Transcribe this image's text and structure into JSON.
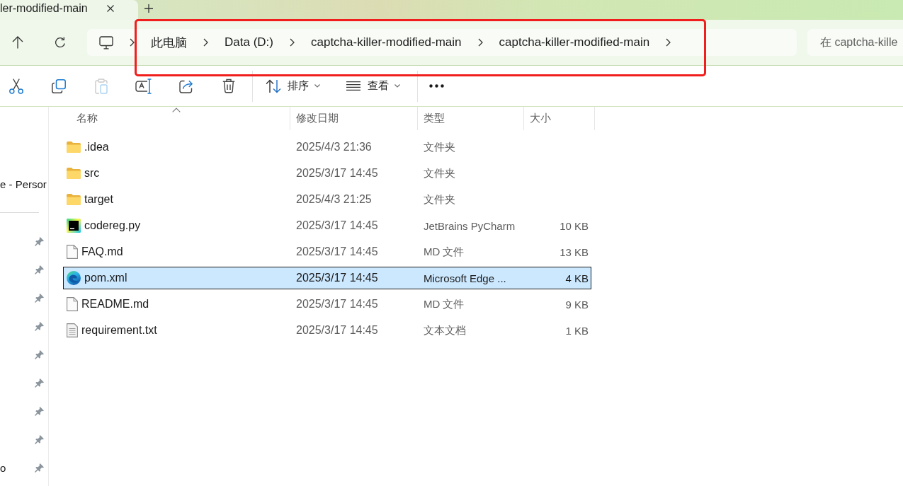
{
  "tab": {
    "title": "ler-modified-main"
  },
  "address_bar": {
    "breadcrumbs": [
      {
        "label": "此电脑"
      },
      {
        "label": "Data (D:)"
      },
      {
        "label": "captcha-killer-modified-main"
      },
      {
        "label": "captcha-killer-modified-main"
      }
    ]
  },
  "search": {
    "placeholder": "在 captcha-kille"
  },
  "toolbar": {
    "actions": [
      {
        "kind": "cut",
        "disabled": false
      },
      {
        "kind": "copy",
        "disabled": false
      },
      {
        "kind": "paste",
        "disabled": true
      },
      {
        "kind": "rename",
        "disabled": false
      },
      {
        "kind": "share",
        "disabled": false
      },
      {
        "kind": "delete",
        "disabled": false
      }
    ],
    "menus": [
      {
        "kind": "sort",
        "label": "排序"
      },
      {
        "kind": "view",
        "label": "查看"
      }
    ]
  },
  "sidebar": {
    "items": [
      {
        "label": "e - Persor"
      }
    ],
    "quick_access": [
      {
        "pinned": true
      },
      {
        "pinned": true
      },
      {
        "pinned": true
      },
      {
        "pinned": true
      },
      {
        "pinned": true
      },
      {
        "pinned": true
      },
      {
        "pinned": true
      },
      {
        "pinned": true
      },
      {
        "label": "o",
        "pinned": true
      }
    ]
  },
  "file_list": {
    "columns": [
      {
        "label": "名称",
        "sorted": true
      },
      {
        "label": "修改日期",
        "sorted": false
      },
      {
        "label": "类型",
        "sorted": false
      },
      {
        "label": "大小",
        "sorted": false
      }
    ],
    "rows": [
      {
        "kind": "folder",
        "name": ".idea",
        "modified": "2025/4/3 21:36",
        "type": "文件夹",
        "selected": false
      },
      {
        "kind": "folder",
        "name": "src",
        "modified": "2025/3/17 14:45",
        "type": "文件夹",
        "selected": false
      },
      {
        "kind": "folder",
        "name": "target",
        "modified": "2025/4/3 21:25",
        "type": "文件夹",
        "selected": false
      },
      {
        "kind": "pycharm",
        "name": "codereg.py",
        "modified": "2025/3/17 14:45",
        "type": "JetBrains PyCharm",
        "size": "10 KB",
        "selected": false
      },
      {
        "kind": "document",
        "name": "FAQ.md",
        "modified": "2025/3/17 14:45",
        "type": "MD 文件",
        "size": "13 KB",
        "selected": false
      },
      {
        "kind": "edge",
        "name": "pom.xml",
        "modified": "2025/3/17 14:45",
        "type": "Microsoft Edge ...",
        "size": "4 KB",
        "selected": true
      },
      {
        "kind": "document",
        "name": "README.md",
        "modified": "2025/3/17 14:45",
        "type": "MD 文件",
        "size": "9 KB",
        "selected": false
      },
      {
        "kind": "text",
        "name": "requirement.txt",
        "modified": "2025/3/17 14:45",
        "type": "文本文档",
        "size": "1 KB",
        "selected": false
      }
    ]
  },
  "annotations": [
    {
      "kind": "rectangle"
    }
  ]
}
